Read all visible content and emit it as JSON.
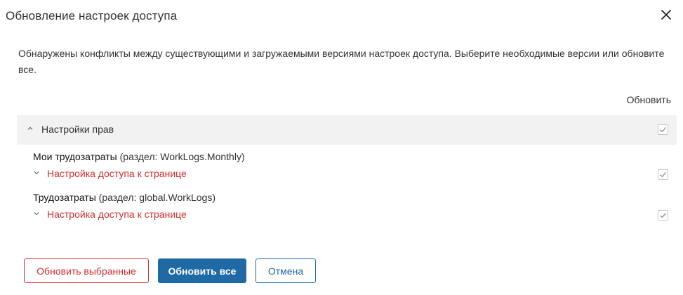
{
  "dialog": {
    "title": "Обновление настроек доступа",
    "message": "Обнаружены конфликты между существующими и загружаемыми версиями настроек доступа. Выберите необходимые версии или обновите все.",
    "column_header": "Обновить"
  },
  "group": {
    "label": "Настройки прав",
    "checked": true,
    "expanded": true
  },
  "items": [
    {
      "name": "Мои трудозатраты",
      "section": "(раздел: WorkLogs.Monthly)",
      "link": "Настройка доступа к странице",
      "checked": true
    },
    {
      "name": "Трудозатраты",
      "section": "(раздел: global.WorkLogs)",
      "link": "Настройка доступа к странице",
      "checked": true
    }
  ],
  "buttons": {
    "update_selected": "Обновить выбранные",
    "update_all": "Обновить все",
    "cancel": "Отмена"
  },
  "colors": {
    "accent": "#1f6aa5",
    "danger": "#d32f2f",
    "group_bg": "#f2f2f2"
  },
  "icons": [
    "close-icon",
    "chevron-up-icon",
    "chevron-down-icon",
    "checkmark-icon"
  ]
}
